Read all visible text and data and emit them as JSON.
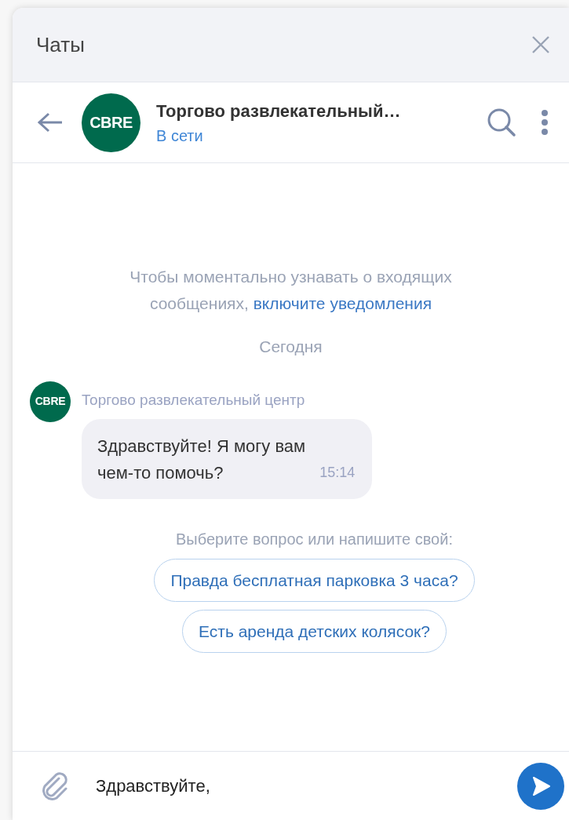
{
  "panel": {
    "title": "Чаты"
  },
  "chat_header": {
    "avatar_text": "CBRE",
    "name": "Торгово развлекательный…",
    "status": "В сети"
  },
  "notice": {
    "text": "Чтобы моментально узнавать о входящих сообщениях,",
    "link": "включите уведомления"
  },
  "date_divider": "Сегодня",
  "messages": [
    {
      "avatar_text": "CBRE",
      "sender": "Торгово развлекательный центр",
      "lines": [
        "Здравствуйте! Я могу вам",
        "чем-то помочь?"
      ],
      "time": "15:14"
    }
  ],
  "suggestions": {
    "prompt": "Выберите вопрос или напишите свой:",
    "options": [
      "Правда бесплатная парковка 3 часа?",
      "Есть аренда детских колясок?"
    ]
  },
  "composer": {
    "value": "Здравствуйте,"
  }
}
